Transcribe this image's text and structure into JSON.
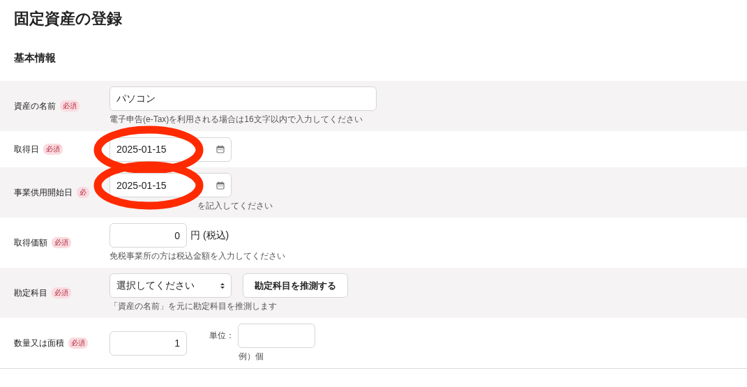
{
  "title": "固定資産の登録",
  "section": "基本情報",
  "rows": [
    {
      "kind": "text",
      "label": "資産の名前",
      "badge": "必須",
      "value": "パソコン",
      "hint": "電子申告(e-Tax)を利用される場合は16文字以内で入力してください"
    },
    {
      "kind": "date",
      "label": "取得日",
      "badge": "必須",
      "value": "2025-01-15",
      "circled": true
    },
    {
      "kind": "date",
      "label": "事業供用開始日",
      "badge": "必",
      "value": "2025-01-15",
      "hint": "を記入してください",
      "circled": true
    },
    {
      "kind": "amount",
      "label": "取得価額",
      "badge": "必須",
      "value": "0",
      "unit": "円 (税込)",
      "hint": "免税事業所の方は税込金額を入力してください"
    },
    {
      "kind": "select",
      "label": "勘定科目",
      "badge": "必須",
      "value": "選択してください",
      "button": "勘定科目を推測する",
      "hint": "「資産の名前」を元に勘定科目を推測します"
    },
    {
      "kind": "quantity",
      "label": "数量又は面積",
      "badge": "必須",
      "value": "1",
      "unit_label": "単位：",
      "unit_hint": "例）個"
    }
  ]
}
